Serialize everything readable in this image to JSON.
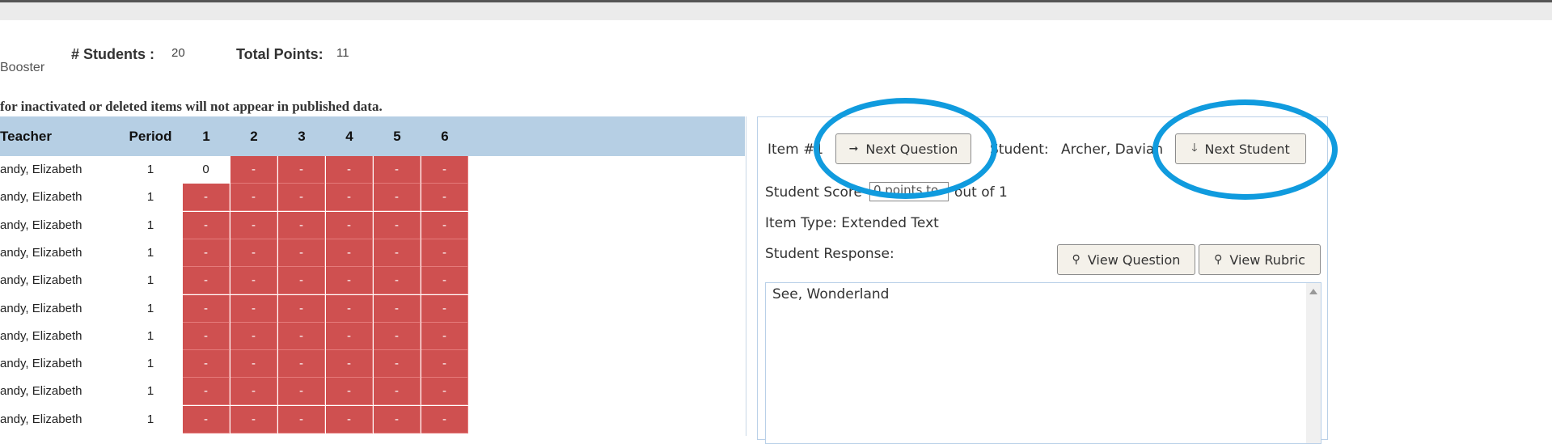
{
  "header": {
    "students_label": "# Students :",
    "students_value": "20",
    "points_label": "Total Points:",
    "points_value": "11",
    "course_fragment": "Booster"
  },
  "notice": "for inactivated or deleted items will not appear in published data.",
  "grid": {
    "headers": [
      "Teacher",
      "Period",
      "1",
      "2",
      "3",
      "4",
      "5",
      "6"
    ],
    "rows": [
      {
        "teacher": "andy, Elizabeth",
        "period": "1",
        "scores": [
          "0",
          "-",
          "-",
          "-",
          "-",
          "-"
        ]
      },
      {
        "teacher": "andy, Elizabeth",
        "period": "1",
        "scores": [
          "-",
          "-",
          "-",
          "-",
          "-",
          "-"
        ]
      },
      {
        "teacher": "andy, Elizabeth",
        "period": "1",
        "scores": [
          "-",
          "-",
          "-",
          "-",
          "-",
          "-"
        ]
      },
      {
        "teacher": "andy, Elizabeth",
        "period": "1",
        "scores": [
          "-",
          "-",
          "-",
          "-",
          "-",
          "-"
        ]
      },
      {
        "teacher": "andy, Elizabeth",
        "period": "1",
        "scores": [
          "-",
          "-",
          "-",
          "-",
          "-",
          "-"
        ]
      },
      {
        "teacher": "andy, Elizabeth",
        "period": "1",
        "scores": [
          "-",
          "-",
          "-",
          "-",
          "-",
          "-"
        ]
      },
      {
        "teacher": "andy, Elizabeth",
        "period": "1",
        "scores": [
          "-",
          "-",
          "-",
          "-",
          "-",
          "-"
        ]
      },
      {
        "teacher": "andy, Elizabeth",
        "period": "1",
        "scores": [
          "-",
          "-",
          "-",
          "-",
          "-",
          "-"
        ]
      },
      {
        "teacher": "andy, Elizabeth",
        "period": "1",
        "scores": [
          "-",
          "-",
          "-",
          "-",
          "-",
          "-"
        ]
      },
      {
        "teacher": "andy, Elizabeth",
        "period": "1",
        "scores": [
          "-",
          "-",
          "-",
          "-",
          "-",
          "-"
        ]
      }
    ]
  },
  "panel": {
    "item_label": "Item #1",
    "next_question": "Next Question",
    "student_label": "Student:",
    "student_name": "Archer, Davian",
    "next_student": "Next Student",
    "score_label": "Student Score",
    "score_value": "0 points to",
    "score_out_of": "out of 1",
    "item_type": "Item Type: Extended Text",
    "response_label": "Student Response:",
    "view_question": "View Question",
    "view_rubric": "View Rubric",
    "response_text": "See, Wonderland"
  },
  "colors": {
    "header_blue": "#b6cfe4",
    "ungraded_red": "#cf5050",
    "annotation_blue": "#109bde"
  },
  "icons": {
    "next_question": "arrow-right-icon",
    "next_student": "arrow-down-icon",
    "view": "magnifier-icon"
  }
}
